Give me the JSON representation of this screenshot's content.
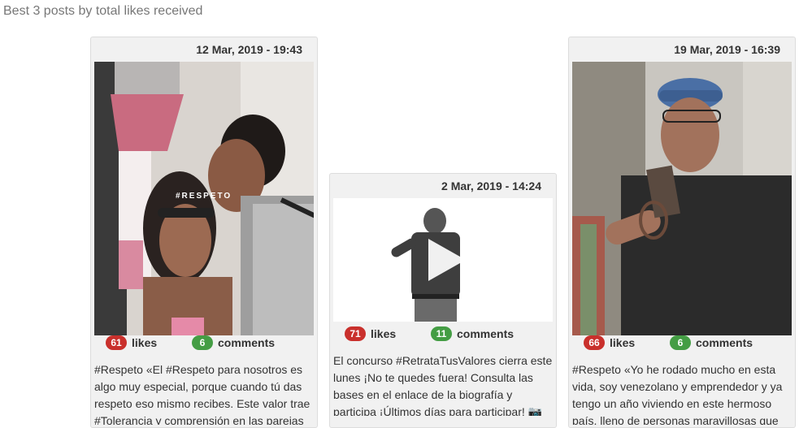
{
  "page": {
    "heading": "Best 3 posts by total likes received"
  },
  "posts": [
    {
      "date": "12 Mar, 2019 - 19:43",
      "likes": "61",
      "likes_label": "likes",
      "comments": "6",
      "comments_label": "comments",
      "photo_overlay_text": "#RESPETO",
      "caption": "#Respeto «El #Respeto para nosotros es algo muy especial, porque cuando tú das respeto eso mismo recibes. Este valor trae #Tolerancia y comprensión en las parejas"
    },
    {
      "date": "2 Mar, 2019 - 14:24",
      "likes": "71",
      "likes_label": "likes",
      "comments": "11",
      "comments_label": "comments",
      "caption": "El concurso #RetrataTusValores cierra este lunes ¡No te quedes fuera! Consulta las bases en el enlace de la biografía y participa ¡Últimos días para participar! 📷"
    },
    {
      "date": "19 Mar, 2019 - 16:39",
      "likes": "66",
      "likes_label": "likes",
      "comments": "6",
      "comments_label": "comments",
      "caption": "#Respeto «Yo he rodado mucho en esta vida, soy venezolano y emprendedor y ya tengo un año viviendo en este hermoso país, lleno de personas maravillosas que"
    }
  ],
  "colors": {
    "likes_badge": "#c9302c",
    "comments_badge": "#449d44"
  }
}
